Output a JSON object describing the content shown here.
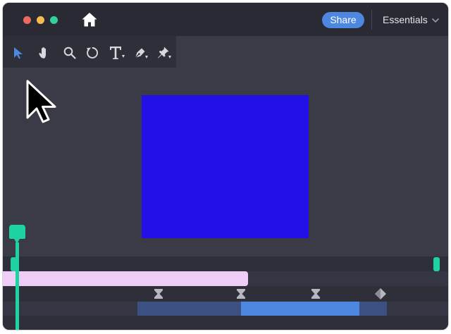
{
  "titlebar": {
    "home_icon": "home-icon",
    "share_label": "Share",
    "workspace_label": "Essentials",
    "workspace_icon": "chevron-down-icon",
    "colors": {
      "share": "#4d87e0",
      "close": "#ee6a5f",
      "minimize": "#f3be4f",
      "zoom": "#30d09a"
    }
  },
  "toolbar": {
    "tools": [
      {
        "name": "selection-tool",
        "icon": "arrow-pointer-icon",
        "active": true
      },
      {
        "name": "hand-tool",
        "icon": "hand-icon",
        "active": false
      },
      {
        "name": "zoom-tool",
        "icon": "magnifier-icon",
        "active": false
      },
      {
        "name": "rotate-tool",
        "icon": "rotate-icon",
        "active": false
      },
      {
        "name": "type-tool",
        "icon": "type-t-icon",
        "active": false
      },
      {
        "name": "pen-tool",
        "icon": "pen-nib-icon",
        "active": false
      },
      {
        "name": "pin-tool",
        "icon": "pin-icon",
        "active": false
      }
    ],
    "active_color": "#4d87e0"
  },
  "canvas": {
    "layer_color": "#2310e6"
  },
  "timeline": {
    "playhead_color": "#1ed3a2",
    "clip_colors": {
      "layer": "#eecdf6",
      "range": "#3c5082",
      "selected_range": "#4d87e0"
    },
    "keyframes": [
      {
        "icon": "hourglass-keyframe-icon"
      },
      {
        "icon": "hourglass-keyframe-icon"
      },
      {
        "icon": "hourglass-keyframe-icon"
      },
      {
        "icon": "diamond-keyframe-icon"
      }
    ]
  }
}
